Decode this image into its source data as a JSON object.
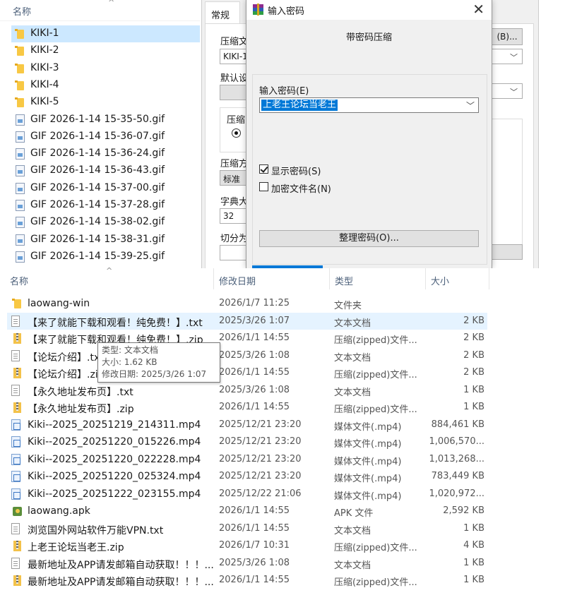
{
  "top_explorer": {
    "header_name": "名称",
    "sort_glyph": "^",
    "items": [
      {
        "label": "KIKI-1",
        "icon": "folder-icon",
        "selected": true
      },
      {
        "label": "KIKI-2",
        "icon": "folder-icon"
      },
      {
        "label": "KIKI-3",
        "icon": "folder-icon"
      },
      {
        "label": "KIKI-4",
        "icon": "folder-icon"
      },
      {
        "label": "KIKI-5",
        "icon": "folder-icon"
      },
      {
        "label": "GIF 2026-1-14 15-35-50.gif",
        "icon": "gif-file-icon"
      },
      {
        "label": "GIF 2026-1-14 15-36-07.gif",
        "icon": "gif-file-icon"
      },
      {
        "label": "GIF 2026-1-14 15-36-24.gif",
        "icon": "gif-file-icon"
      },
      {
        "label": "GIF 2026-1-14 15-36-43.gif",
        "icon": "gif-file-icon"
      },
      {
        "label": "GIF 2026-1-14 15-37-00.gif",
        "icon": "gif-file-icon"
      },
      {
        "label": "GIF 2026-1-14 15-37-28.gif",
        "icon": "gif-file-icon"
      },
      {
        "label": "GIF 2026-1-14 15-38-02.gif",
        "icon": "gif-file-icon"
      },
      {
        "label": "GIF 2026-1-14 15-38-31.gif",
        "icon": "gif-file-icon"
      },
      {
        "label": "GIF 2026-1-14 15-39-25.gif",
        "icon": "gif-file-icon"
      }
    ]
  },
  "archive_dialog": {
    "tab_general": "常规",
    "archive_name_label": "压缩文",
    "archive_name_value": "KIKI-1.",
    "browse_button": "(B)...",
    "default_profile_label": "默认设",
    "format_label": "压缩",
    "method_label": "压缩方",
    "method_value": "标准",
    "dict_label": "字典大",
    "dict_value": "32",
    "split_label": "切分为"
  },
  "password_dialog": {
    "title": "输入密码",
    "heading": "带密码压缩",
    "password_label": "输入密码(E)",
    "password_value": "上老王论坛当老王",
    "show_password_label": "显示密码(S)",
    "show_password_checked": true,
    "encrypt_names_label": "加密文件名(N)",
    "encrypt_names_checked": false,
    "organize_button": "整理密码(O)...",
    "close_glyph": "✕",
    "accent": "#0078d7"
  },
  "file_list": {
    "columns": {
      "name": "名称",
      "date": "修改日期",
      "type": "类型",
      "size": "大小"
    },
    "sort_glyph": "^",
    "rows": [
      {
        "name": "laowang-win",
        "date": "2026/1/7 11:25",
        "type": "文件夹",
        "size": "",
        "icon": "folder-icon"
      },
      {
        "name": "【来了就能下载和观看！纯免费！】.txt",
        "date": "2025/3/26 1:07",
        "type": "文本文档",
        "size": "2 KB",
        "icon": "text-file-icon",
        "hot": true
      },
      {
        "name": "【来了就能下载和观看！纯免费！】.zip",
        "date": "2026/1/1 14:55",
        "type": "压缩(zipped)文件...",
        "size": "2 KB",
        "icon": "zip-file-icon"
      },
      {
        "name": "【论坛介绍】.txt",
        "date": "2025/3/26 1:08",
        "type": "文本文档",
        "size": "2 KB",
        "icon": "text-file-icon"
      },
      {
        "name": "【论坛介绍】.zip",
        "date": "2026/1/1 14:55",
        "type": "压缩(zipped)文件...",
        "size": "2 KB",
        "icon": "zip-file-icon"
      },
      {
        "name": "【永久地址发布页】.txt",
        "date": "2025/3/26 1:08",
        "type": "文本文档",
        "size": "1 KB",
        "icon": "text-file-icon"
      },
      {
        "name": "【永久地址发布页】.zip",
        "date": "2026/1/1 14:55",
        "type": "压缩(zipped)文件...",
        "size": "1 KB",
        "icon": "zip-file-icon"
      },
      {
        "name": "Kiki--2025_20251219_214311.mp4",
        "date": "2025/12/21 23:20",
        "type": "媒体文件(.mp4)",
        "size": "884,461 KB",
        "icon": "video-file-icon"
      },
      {
        "name": "Kiki--2025_20251220_015226.mp4",
        "date": "2025/12/21 23:20",
        "type": "媒体文件(.mp4)",
        "size": "1,006,570...",
        "icon": "video-file-icon"
      },
      {
        "name": "Kiki--2025_20251220_022228.mp4",
        "date": "2025/12/21 23:20",
        "type": "媒体文件(.mp4)",
        "size": "1,013,268...",
        "icon": "video-file-icon"
      },
      {
        "name": "Kiki--2025_20251220_025324.mp4",
        "date": "2025/12/21 23:20",
        "type": "媒体文件(.mp4)",
        "size": "783,449 KB",
        "icon": "video-file-icon"
      },
      {
        "name": "Kiki--2025_20251222_023155.mp4",
        "date": "2025/12/22 21:06",
        "type": "媒体文件(.mp4)",
        "size": "1,020,972...",
        "icon": "video-file-icon"
      },
      {
        "name": "laowang.apk",
        "date": "2026/1/1 14:55",
        "type": "APK 文件",
        "size": "2,592 KB",
        "icon": "apk-file-icon"
      },
      {
        "name": "浏览国外网站软件万能VPN.txt",
        "date": "2026/1/1 14:55",
        "type": "文本文档",
        "size": "1 KB",
        "icon": "text-file-icon"
      },
      {
        "name": "上老王论坛当老王.zip",
        "date": "2026/1/7 10:31",
        "type": "压缩(zipped)文件...",
        "size": "4 KB",
        "icon": "zip-file-icon"
      },
      {
        "name": "最新地址及APP请发邮箱自动获取！！！...",
        "date": "2025/3/26 1:08",
        "type": "文本文档",
        "size": "1 KB",
        "icon": "text-file-icon"
      },
      {
        "name": "最新地址及APP请发邮箱自动获取！！！...",
        "date": "2026/1/1 14:55",
        "type": "压缩(zipped)文件...",
        "size": "1 KB",
        "icon": "zip-file-icon"
      }
    ]
  },
  "tooltip": {
    "type_line": "类型: 文本文档",
    "size_line": "大小: 1.62 KB",
    "date_line": "修改日期: 2025/3/26 1:07"
  }
}
